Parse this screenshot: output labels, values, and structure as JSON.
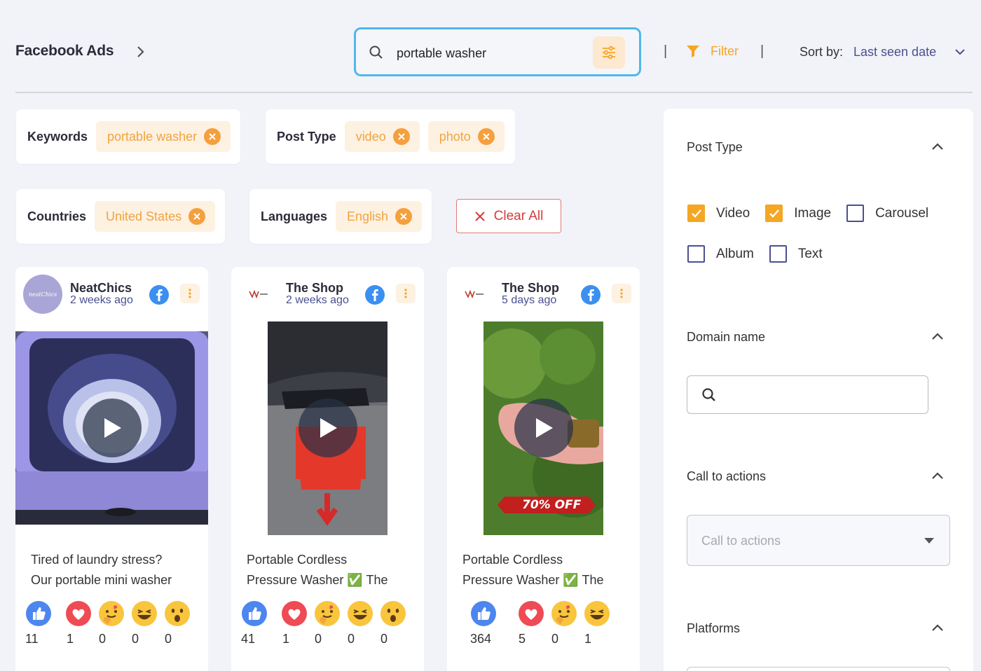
{
  "header": {
    "brand": "Facebook Ads",
    "search_value": "portable washer",
    "separator": "|",
    "filter_label": "Filter",
    "sort_label": "Sort by:",
    "sort_value": "Last seen date"
  },
  "filters": {
    "keywords": {
      "label": "Keywords",
      "chips": [
        "portable washer"
      ]
    },
    "post_type": {
      "label": "Post Type",
      "chips": [
        "video",
        "photo"
      ]
    },
    "countries": {
      "label": "Countries",
      "chips": [
        "United States"
      ]
    },
    "languages": {
      "label": "Languages",
      "chips": [
        "English"
      ]
    },
    "clear_all": "Clear All"
  },
  "cards": [
    {
      "page_name": "NeatChics",
      "posted": "2 weeks ago",
      "avatar_text": "neatChics",
      "caption_lines": [
        "Tired of laundry stress?",
        "Our portable mini washer"
      ],
      "counts": [
        "11",
        "1",
        "0",
        "0",
        "0"
      ]
    },
    {
      "page_name": "The Shop",
      "posted": "2 weeks ago",
      "caption_lines": [
        "Portable Cordless",
        "Pressure Washer ✅ The"
      ],
      "counts": [
        "41",
        "1",
        "0",
        "0",
        "0"
      ]
    },
    {
      "page_name": "The Shop",
      "posted": "5 days ago",
      "badge": "70% OFF",
      "caption_lines": [
        "Portable Cordless",
        "Pressure Washer ✅ The"
      ],
      "counts": [
        "364",
        "5",
        "0",
        "1"
      ]
    }
  ],
  "sidebar": {
    "post_type": {
      "title": "Post Type",
      "options": [
        {
          "label": "Video",
          "checked": true
        },
        {
          "label": "Image",
          "checked": true
        },
        {
          "label": "Carousel",
          "checked": false
        },
        {
          "label": "Album",
          "checked": false
        },
        {
          "label": "Text",
          "checked": false
        }
      ]
    },
    "domain_name": {
      "title": "Domain name"
    },
    "call_to_actions": {
      "title": "Call to actions",
      "placeholder": "Call to actions"
    },
    "platforms": {
      "title": "Platforms"
    }
  },
  "colors": {
    "accent_orange": "#f5a623",
    "search_border": "#4fb8ec",
    "link_blue": "#4a5090",
    "clear_red": "#d93a3a"
  }
}
